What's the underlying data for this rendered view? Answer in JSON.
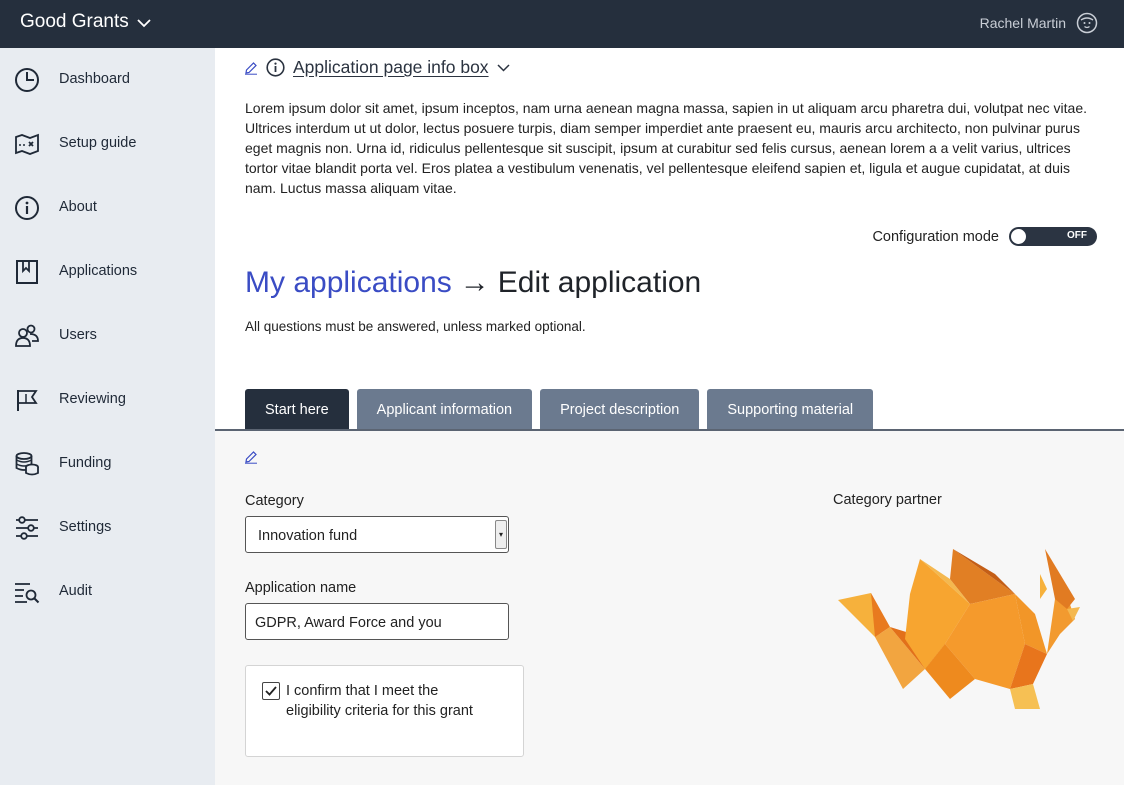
{
  "app": {
    "brand": "Good Grants",
    "user_name": "Rachel Martin"
  },
  "sidebar": {
    "items": [
      {
        "label": "Dashboard",
        "icon": "dashboard-icon"
      },
      {
        "label": "Setup guide",
        "icon": "map-icon"
      },
      {
        "label": "About",
        "icon": "info-icon"
      },
      {
        "label": "Applications",
        "icon": "bookmark-icon"
      },
      {
        "label": "Users",
        "icon": "users-icon"
      },
      {
        "label": "Reviewing",
        "icon": "flag-icon"
      },
      {
        "label": "Funding",
        "icon": "coins-icon"
      },
      {
        "label": "Settings",
        "icon": "sliders-icon"
      },
      {
        "label": "Audit",
        "icon": "audit-search-icon"
      }
    ]
  },
  "infobox": {
    "title": "Application page info box",
    "text": "Lorem ipsum dolor sit amet, ipsum inceptos, nam urna aenean magna massa, sapien in ut aliquam arcu pharetra dui, volutpat nec vitae. Ultrices interdum ut ut dolor, lectus posuere turpis, diam semper imperdiet ante praesent eu, mauris arcu architecto, non pulvinar purus eget magnis non. Urna id, ridiculus pellentesque sit suscipit, ipsum at curabitur sed felis cursus, aenean lorem a a velit varius, ultrices tortor vitae blandit porta vel. Eros platea a vestibulum venenatis, vel pellentesque eleifend sapien et, ligula et augue cupidatat, at duis nam. Luctus massa aliquam vitae."
  },
  "config_mode": {
    "label": "Configuration mode",
    "state": "OFF"
  },
  "page": {
    "breadcrumb": "My applications",
    "arrow": "→",
    "title": "Edit application",
    "note": "All questions must be answered, unless marked optional."
  },
  "tabs": [
    {
      "label": "Start here",
      "active": true
    },
    {
      "label": "Applicant information",
      "active": false
    },
    {
      "label": "Project description",
      "active": false
    },
    {
      "label": "Supporting material",
      "active": false
    }
  ],
  "form": {
    "category_label": "Category",
    "category_value": "Innovation fund",
    "application_name_label": "Application name",
    "application_name_value": "GDPR, Award Force and you",
    "eligibility_text": "I confirm that I meet the eligibility criteria for this grant",
    "eligibility_checked": true,
    "partner_label": "Category partner"
  },
  "colors": {
    "topbar": "#252f3d",
    "sidebar": "#e8ecf1",
    "link": "#3a4cc4",
    "tab_active": "#252f3d",
    "tab_inactive": "#6b7a8f"
  }
}
